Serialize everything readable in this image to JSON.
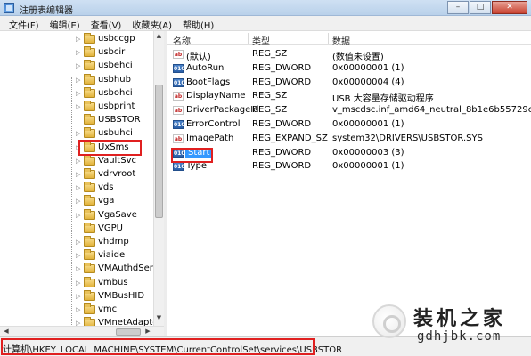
{
  "window": {
    "title": "注册表编辑器",
    "minimize": "–",
    "maximize": "□",
    "close": "✕"
  },
  "menu": [
    "文件(F)",
    "编辑(E)",
    "查看(V)",
    "收藏夹(A)",
    "帮助(H)"
  ],
  "tree": {
    "items": [
      {
        "label": "usbccgp",
        "expandable": true
      },
      {
        "label": "usbcir",
        "expandable": true
      },
      {
        "label": "usbehci",
        "expandable": true
      },
      {
        "label": "usbhub",
        "expandable": true
      },
      {
        "label": "usbohci",
        "expandable": true
      },
      {
        "label": "usbprint",
        "expandable": true
      },
      {
        "label": "USBSTOR",
        "expandable": false,
        "selected": true
      },
      {
        "label": "usbuhci",
        "expandable": true
      },
      {
        "label": "UxSms",
        "expandable": true
      },
      {
        "label": "VaultSvc",
        "expandable": true
      },
      {
        "label": "vdrvroot",
        "expandable": true
      },
      {
        "label": "vds",
        "expandable": true
      },
      {
        "label": "vga",
        "expandable": true
      },
      {
        "label": "VgaSave",
        "expandable": true
      },
      {
        "label": "VGPU",
        "expandable": false
      },
      {
        "label": "vhdmp",
        "expandable": true
      },
      {
        "label": "viaide",
        "expandable": true
      },
      {
        "label": "VMAuthdService",
        "expandable": true
      },
      {
        "label": "vmbus",
        "expandable": true
      },
      {
        "label": "VMBusHID",
        "expandable": true
      },
      {
        "label": "vmci",
        "expandable": true
      },
      {
        "label": "VMnetAdapter",
        "expandable": true
      }
    ]
  },
  "values": {
    "headers": {
      "name": "名称",
      "type": "类型",
      "data": "数据"
    },
    "rows": [
      {
        "icon": "string-value-icon",
        "name": "(默认)",
        "type": "REG_SZ",
        "data": "(数值未设置)"
      },
      {
        "icon": "dword-value-icon",
        "name": "AutoRun",
        "type": "REG_DWORD",
        "data": "0x00000001 (1)"
      },
      {
        "icon": "dword-value-icon",
        "name": "BootFlags",
        "type": "REG_DWORD",
        "data": "0x00000004 (4)"
      },
      {
        "icon": "string-value-icon",
        "name": "DisplayName",
        "type": "REG_SZ",
        "data": "USB 大容量存储驱动程序"
      },
      {
        "icon": "string-value-icon",
        "name": "DriverPackageId",
        "type": "REG_SZ",
        "data": "v_mscdsc.inf_amd64_neutral_8b1e6b55729c32..."
      },
      {
        "icon": "dword-value-icon",
        "name": "ErrorControl",
        "type": "REG_DWORD",
        "data": "0x00000001 (1)"
      },
      {
        "icon": "string-value-icon",
        "name": "ImagePath",
        "type": "REG_EXPAND_SZ",
        "data": "system32\\DRIVERS\\USBSTOR.SYS"
      },
      {
        "icon": "dword-value-icon",
        "name": "Start",
        "type": "REG_DWORD",
        "data": "0x00000003 (3)",
        "highlighted": true
      },
      {
        "icon": "dword-value-icon",
        "name": "Type",
        "type": "REG_DWORD",
        "data": "0x00000001 (1)"
      }
    ]
  },
  "status": {
    "path": "计算机\\HKEY_LOCAL_MACHINE\\SYSTEM\\CurrentControlSet\\services\\USBSTOR"
  },
  "watermark": {
    "title": "装机之家",
    "url": "gdhjbk.com"
  },
  "colors": {
    "annotation_red": "#e02020",
    "selection_blue": "#3399ff",
    "folder": "#e2b33b"
  }
}
